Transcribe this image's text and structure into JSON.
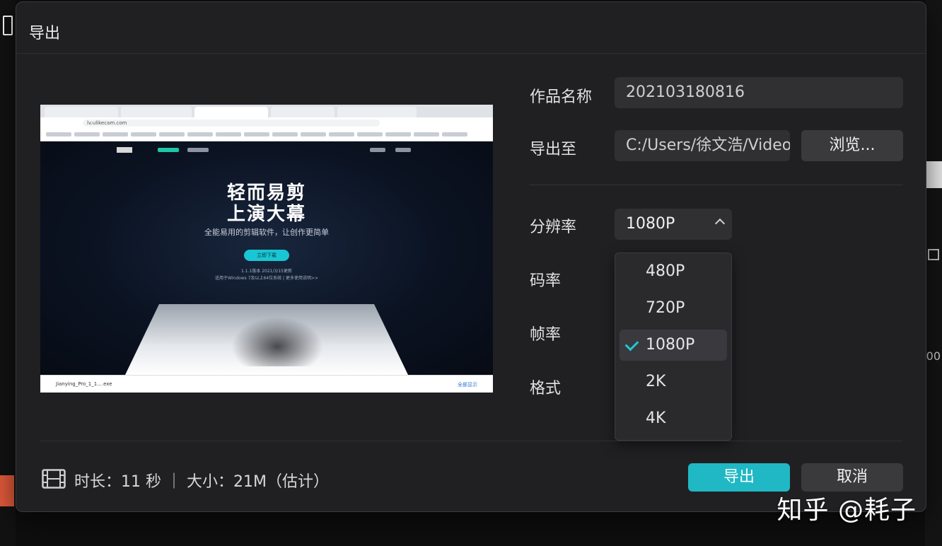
{
  "dialog": {
    "title": "导出"
  },
  "preview": {
    "url": "lv.ulikecam.com",
    "hero_line1": "轻而易剪",
    "hero_line2": "上演大幕",
    "hero_sub": "全能易用的剪辑软件，让创作更简单",
    "cta": "立即下载",
    "version_line1": "1.1.1版本 2021/3/15更新",
    "version_line2": "适用于Windows 7及以上64位系统 | 更多使用说明>>",
    "download_file": "Jianying_Pro_1_1....exe",
    "download_right": "全部显示"
  },
  "form": {
    "name_label": "作品名称",
    "name_value": "202103180816",
    "export_to_label": "导出至",
    "export_path": "C:/Users/徐文浩/Videos",
    "browse_label": "浏览...",
    "resolution_label": "分辨率",
    "resolution_value": "1080P",
    "bitrate_label": "码率",
    "framerate_label": "帧率",
    "format_label": "格式"
  },
  "resolution_options": [
    {
      "label": "480P"
    },
    {
      "label": "720P"
    },
    {
      "label": "1080P"
    },
    {
      "label": "2K"
    },
    {
      "label": "4K"
    }
  ],
  "resolution_selected": "1080P",
  "footer": {
    "info": "时长：11 秒 ｜ 大小：21M（估计）",
    "export_label": "导出",
    "cancel_label": "取消"
  },
  "watermark": "知乎 @耗子",
  "colors": {
    "accent": "#1fb8c4",
    "dialog_bg": "#202022",
    "field_bg": "#303033"
  }
}
